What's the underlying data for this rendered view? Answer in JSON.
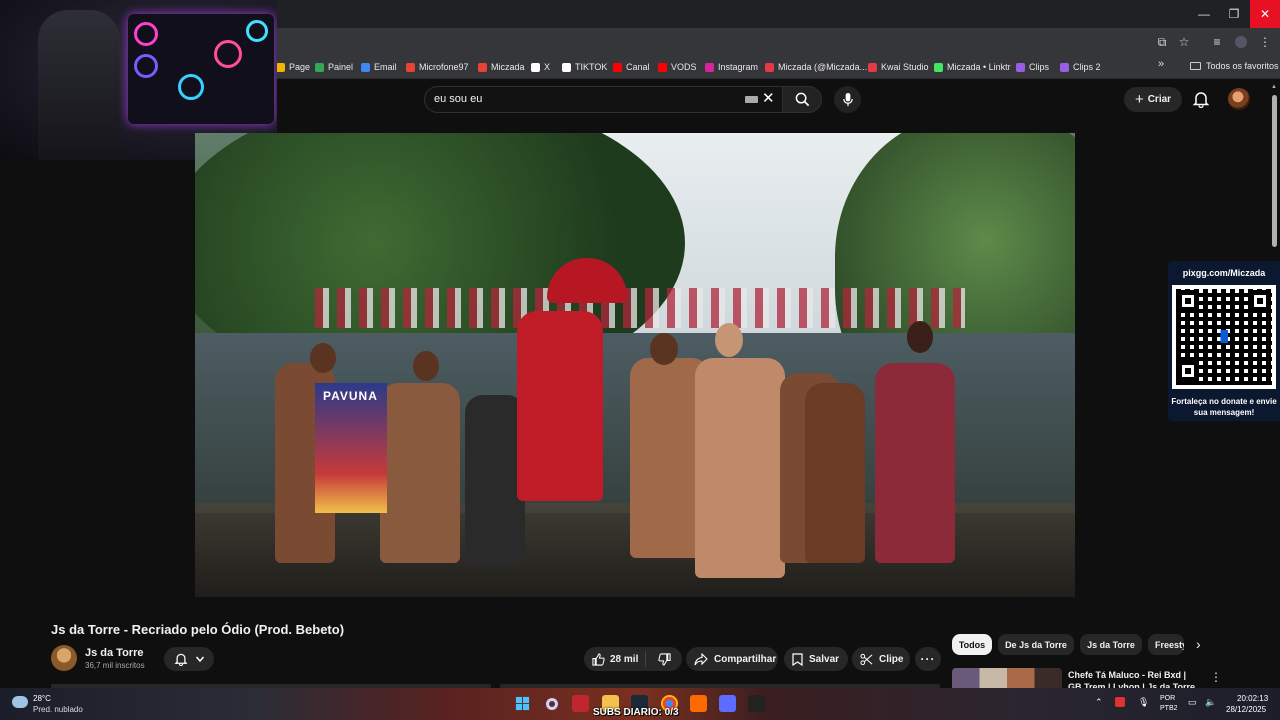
{
  "window": {
    "minimize": "—",
    "maximize": "❐",
    "close": "✕"
  },
  "bookmarks": {
    "items": [
      {
        "label": "Page",
        "color": "#f4b400"
      },
      {
        "label": "Painel",
        "color": "#34a853"
      },
      {
        "label": "Email",
        "color": "#4285f4"
      },
      {
        "label": "Microfone97",
        "color": "#ea4335"
      },
      {
        "label": "Miczada",
        "color": "#ea4335"
      },
      {
        "label": "X",
        "color": "#ffffff"
      },
      {
        "label": "TIKTOK",
        "color": "#ffffff"
      },
      {
        "label": "Canal",
        "color": "#ff0000"
      },
      {
        "label": "VODS",
        "color": "#ff0000"
      },
      {
        "label": "Instagram",
        "color": "#d6249f"
      },
      {
        "label": "Miczada (@Miczada...",
        "color": "#e63946"
      },
      {
        "label": "Kwai Studio",
        "color": "#e63946"
      },
      {
        "label": "Miczada • Linktr",
        "color": "#43e660"
      },
      {
        "label": "Clips",
        "color": "#9b5de5"
      },
      {
        "label": "Clips 2",
        "color": "#9b5de5"
      }
    ],
    "more": "»",
    "favorites_folder": "Todos os favoritos"
  },
  "search": {
    "query": "eu sou eu"
  },
  "header": {
    "create_label": "Criar"
  },
  "video": {
    "title": "Js da Torre - Recriado pelo Ódio (Prod. Bebeto)",
    "flag_text": "PAVUNA"
  },
  "channel": {
    "name": "Js da Torre",
    "subscribers": "36,7 mil inscritos"
  },
  "actions": {
    "likes": "28 mil",
    "share": "Compartilhar",
    "save": "Salvar",
    "clip": "Clipe",
    "more": "···"
  },
  "qr_panel": {
    "title": "pixgg.com/Miczada",
    "caption": "Fortaleça no donate e envie sua mensagem!"
  },
  "chips": [
    "Todos",
    "De Js da Torre",
    "Js da Torre",
    "Freestyle"
  ],
  "related": {
    "title": "Chefe Tá Maluco - Rei Bxd | GB Trem | Lyhon | Js da Torre (Pro..."
  },
  "taskbar": {
    "temperature": "28°C",
    "weather": "Pred. nublado",
    "subs_overlay": "SUBS DIARIO: 0/3",
    "lang_top": "POR",
    "lang_bottom": "PTB2",
    "time": "20:02:13",
    "date": "28/12/2025"
  }
}
